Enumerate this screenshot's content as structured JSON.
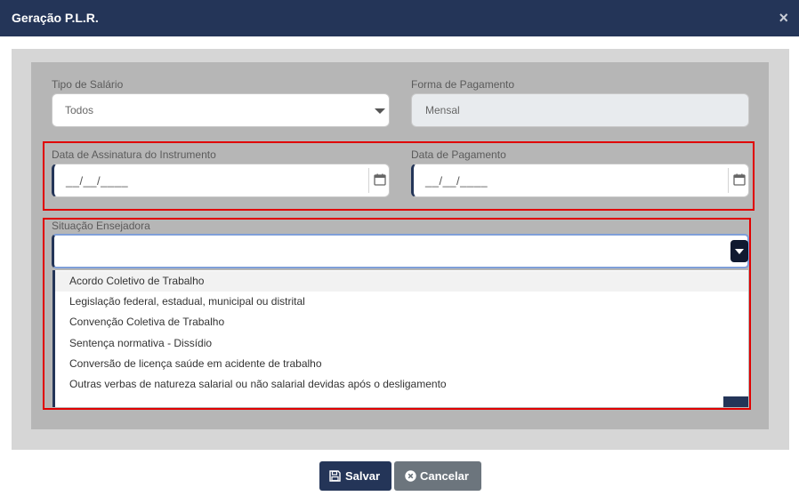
{
  "dialog": {
    "title": "Geração P.L.R.",
    "close_glyph": "×"
  },
  "form": {
    "tipo_salario": {
      "label": "Tipo de Salário",
      "value": "Todos"
    },
    "forma_pagamento": {
      "label": "Forma de Pagamento",
      "value": "Mensal"
    },
    "data_assinatura": {
      "label": "Data de Assinatura do Instrumento",
      "value": "__/__/____"
    },
    "data_pagamento": {
      "label": "Data de Pagamento",
      "value": "__/__/____"
    },
    "situacao": {
      "label": "Situação Ensejadora",
      "value": "",
      "options": [
        "Acordo Coletivo de Trabalho",
        "Legislação federal, estadual, municipal ou distrital",
        "Convenção Coletiva de Trabalho",
        "Sentença normativa - Dissídio",
        "Conversão de licença saúde em acidente de trabalho",
        "Outras verbas de natureza salarial ou não salarial devidas após o desligamento"
      ]
    }
  },
  "buttons": {
    "save": "Salvar",
    "cancel": "Cancelar"
  },
  "colors": {
    "header": "#243558",
    "highlight": "#e00000",
    "cancel": "#6c757d"
  }
}
